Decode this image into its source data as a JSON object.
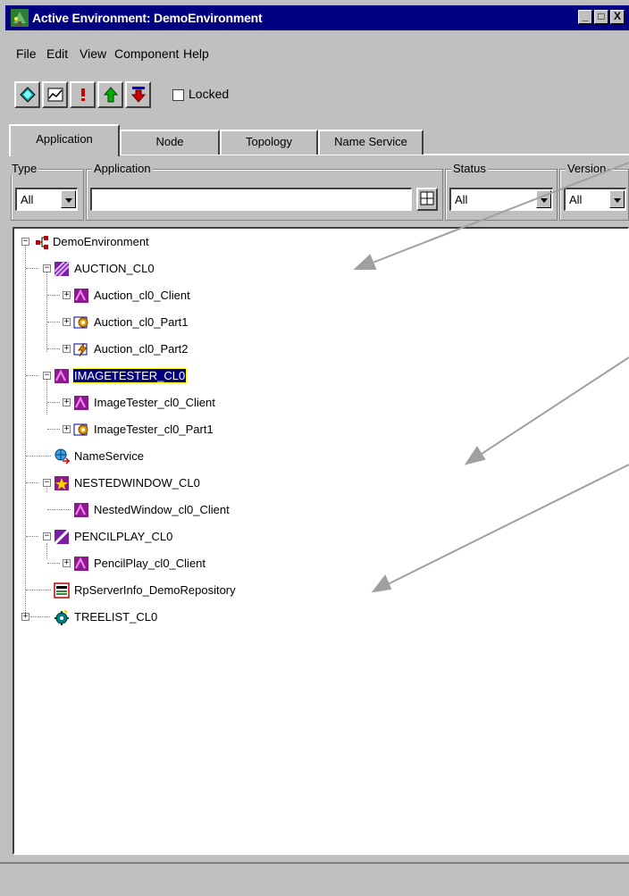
{
  "window": {
    "title": "Active Environment: DemoEnvironment",
    "controls": [
      "_",
      "□",
      "X"
    ]
  },
  "menubar": [
    "File",
    "Edit",
    "View",
    "Component",
    "Help"
  ],
  "toolbar": {
    "buttons": [
      "diamond-icon",
      "chart-icon",
      "exclamation-icon",
      "up-arrow-icon",
      "down-arrow-icon"
    ],
    "locked_label": "Locked",
    "locked_checked": false
  },
  "tabs": [
    {
      "label": "Application",
      "active": true
    },
    {
      "label": "Node",
      "active": false
    },
    {
      "label": "Topology",
      "active": false
    },
    {
      "label": "Name Service",
      "active": false
    }
  ],
  "filters": {
    "type": {
      "label": "Type",
      "value": "All"
    },
    "application": {
      "label": "Application",
      "value": ""
    },
    "status": {
      "label": "Status",
      "value": "All"
    },
    "version": {
      "label": "Version",
      "value": "All"
    }
  },
  "tree": {
    "root": "DemoEnvironment",
    "nodes": [
      {
        "label": "AUCTION_CL0",
        "icon": "partition-stripe-icon"
      },
      {
        "label": "Auction_cl0_Client",
        "icon": "client-icon"
      },
      {
        "label": "Auction_cl0_Part1",
        "icon": "part-gear-icon"
      },
      {
        "label": "Auction_cl0_Part2",
        "icon": "part-bolt-icon"
      },
      {
        "label": "IMAGETESTER_CL0",
        "icon": "client-icon",
        "selected": true
      },
      {
        "label": "ImageTester_cl0_Client",
        "icon": "client-icon"
      },
      {
        "label": "ImageTester_cl0_Part1",
        "icon": "part-gear-icon"
      },
      {
        "label": "NameService",
        "icon": "name-service-icon"
      },
      {
        "label": "NESTEDWINDOW_CL0",
        "icon": "partition-star-icon"
      },
      {
        "label": "NestedWindow_cl0_Client",
        "icon": "client-icon"
      },
      {
        "label": "PENCILPLAY_CL0",
        "icon": "partition-slash-icon"
      },
      {
        "label": "PencilPlay_cl0_Client",
        "icon": "client-icon"
      },
      {
        "label": "RpServerInfo_DemoRepository",
        "icon": "server-info-icon"
      },
      {
        "label": "TREELIST_CL0",
        "icon": "gear-teal-icon"
      }
    ]
  },
  "colors": {
    "titlebar": "#000080",
    "selection": "#000080",
    "face": "#c0c0c0",
    "client_icon": "#8b1a8b",
    "arrow": "#a0a0a0"
  }
}
